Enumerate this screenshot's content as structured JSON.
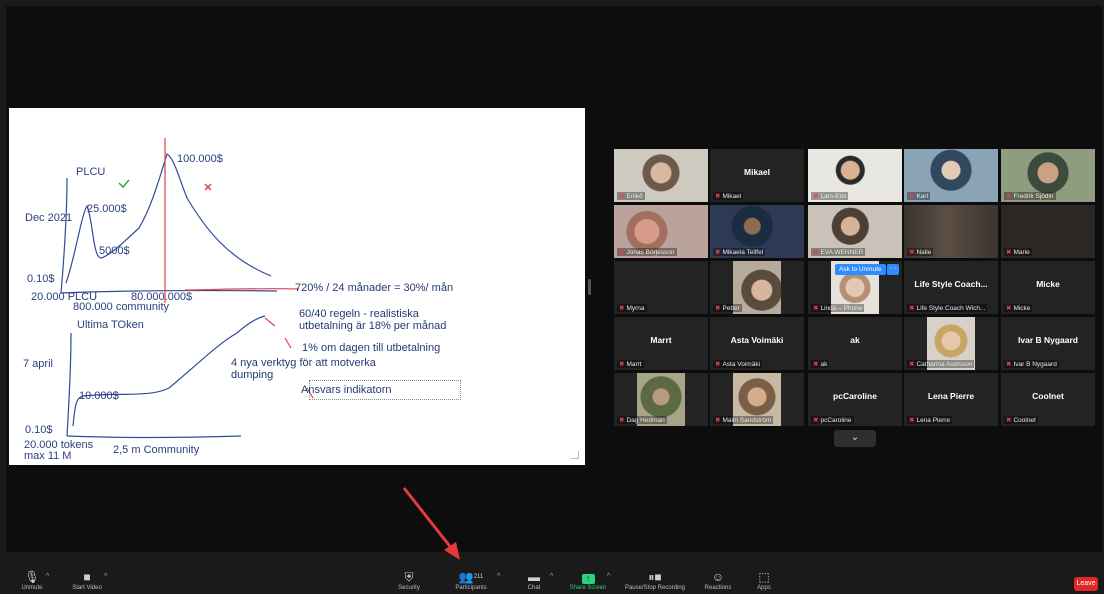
{
  "whiteboard": {
    "texts": {
      "plcu": "PLCU",
      "dec2021": "Dec 2021",
      "p25000": "25.000$",
      "p5000": "5000$",
      "p010a": "0.10$",
      "p100000": "100.000$",
      "plcu20000": "20.000 PLCU",
      "community800": "800.000 community",
      "p80000000": "80.000.000$",
      "calc": "720% / 24 månader = 30%/ mån",
      "rule": "60/40 regeln - realistiska\nutbetalning är 18% per månad",
      "percent": "1% om dagen till utbetalning",
      "tools": "4 nya verktyg för att motverka\ndumping",
      "ansvar": "Ansvars indikatorn",
      "ultima": "Ultima TOken",
      "april": "7 april",
      "p10000": "10.000$",
      "p010b": "0.10$",
      "tokens": "20.000 tokens\nmax 11 M",
      "community25": "2,5 m Community"
    }
  },
  "participants": [
    {
      "id": "eniko",
      "label": "Enikő",
      "video": "v1",
      "active": true
    },
    {
      "id": "mikael",
      "label": "Mikael",
      "center": "Mikael"
    },
    {
      "id": "lars",
      "label": "Lars-Eric",
      "video": "v2"
    },
    {
      "id": "karl",
      "label": "Karl",
      "video": "v3"
    },
    {
      "id": "fredrik",
      "label": "Fredrik Sjödin",
      "video": "v4"
    },
    {
      "id": "jonas",
      "label": "Jonas Börjesson",
      "video": "v5"
    },
    {
      "id": "mikaela",
      "label": "Mikaela Tellfel",
      "video": "v6"
    },
    {
      "id": "eva",
      "label": "EVA WENNER",
      "video": "v7"
    },
    {
      "id": "nalle",
      "label": "Nalle",
      "video": "v8"
    },
    {
      "id": "marie",
      "label": "Marie",
      "video": "v9"
    },
    {
      "id": "myrna",
      "label": "Myrna"
    },
    {
      "id": "petter",
      "label": "Petter",
      "video": "v10"
    },
    {
      "id": "linda",
      "label": "Linda – Phone",
      "video": "v11"
    },
    {
      "id": "lifestyle",
      "label": "Life Style Coach Wich...",
      "center": "Life Style Coach..."
    },
    {
      "id": "micke",
      "label": "Micke",
      "center": "Micke"
    },
    {
      "id": "marrt",
      "label": "Marrt",
      "center": "Marrt"
    },
    {
      "id": "asta",
      "label": "Asta Voimäki",
      "center": "Asta Voimäki"
    },
    {
      "id": "ak",
      "label": "ak",
      "center": "ak"
    },
    {
      "id": "catharina",
      "label": "Catharina Axelsson",
      "video": "v12"
    },
    {
      "id": "ivar",
      "label": "Ivar B Nygaard",
      "center": "Ivar B Nygaard"
    },
    {
      "id": "dag",
      "label": "Dag Hedman",
      "video": "v13"
    },
    {
      "id": "malin",
      "label": "Malin Sandström",
      "video": "v14"
    },
    {
      "id": "pccaroline",
      "label": "pcCaroline",
      "center": "pcCaroline"
    },
    {
      "id": "lenapierre",
      "label": "Lena Pierre",
      "center": "Lena Pierre"
    },
    {
      "id": "coolnet",
      "label": "Coolnet",
      "center": "Coolnet"
    }
  ],
  "ask_unmute": "Ask to Unmute",
  "more": "···",
  "pager_icon": "chevron-down",
  "toolbar": {
    "unmute": "Unmute",
    "start_video": "Start Video",
    "security": "Security",
    "participants": "Participants",
    "participants_count": "211",
    "chat": "Chat",
    "share_screen": "Share Screen",
    "pause_recording": "Pause/Stop Recording",
    "reactions": "Reactions",
    "apps": "Apps",
    "leave": "Leave"
  },
  "colors": {
    "accent_green": "#27d07a",
    "active_speaker": "#b8de3c",
    "leave_red": "#e02828",
    "ink_blue": "#2a3f7d",
    "arrow_red": "#e53a3a"
  }
}
